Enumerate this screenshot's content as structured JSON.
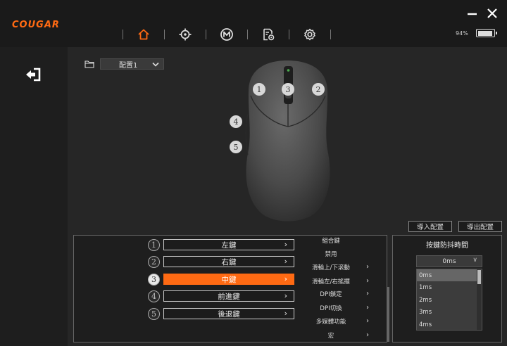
{
  "app": {
    "logo": "COUGAR"
  },
  "nav": {
    "items": [
      "home-icon",
      "dpi-icon",
      "macro-icon",
      "settings-profile-icon",
      "gear-icon"
    ],
    "active": "home-icon",
    "accent": "#ff6a13"
  },
  "status": {
    "battery_text": "94%",
    "battery_level": 0.94
  },
  "profile": {
    "selected": "配置1"
  },
  "mouse": {
    "labels": [
      "1",
      "2",
      "3",
      "4",
      "5"
    ]
  },
  "actions": {
    "import": "導入配置",
    "export": "導出配置"
  },
  "buttons": [
    {
      "num": "1",
      "label": "左鍵",
      "selected": false
    },
    {
      "num": "2",
      "label": "右鍵",
      "selected": false
    },
    {
      "num": "3",
      "label": "中鍵",
      "selected": true
    },
    {
      "num": "4",
      "label": "前進鍵",
      "selected": false
    },
    {
      "num": "5",
      "label": "後退鍵",
      "selected": false
    }
  ],
  "functions": [
    {
      "label": "組合鍵",
      "has_sub": false
    },
    {
      "label": "禁用",
      "has_sub": false
    },
    {
      "label": "滑輪上/下滚動",
      "has_sub": true
    },
    {
      "label": "滑輪左/右搖擺",
      "has_sub": true
    },
    {
      "label": "DPI鎖定",
      "has_sub": true
    },
    {
      "label": "DPI切換",
      "has_sub": true
    },
    {
      "label": "多媒體功能",
      "has_sub": true
    },
    {
      "label": "宏",
      "has_sub": true
    }
  ],
  "debounce": {
    "title": "按鍵防抖時間",
    "value": "0ms",
    "options": [
      "0ms",
      "1ms",
      "2ms",
      "3ms",
      "4ms"
    ],
    "selected_index": 0
  }
}
